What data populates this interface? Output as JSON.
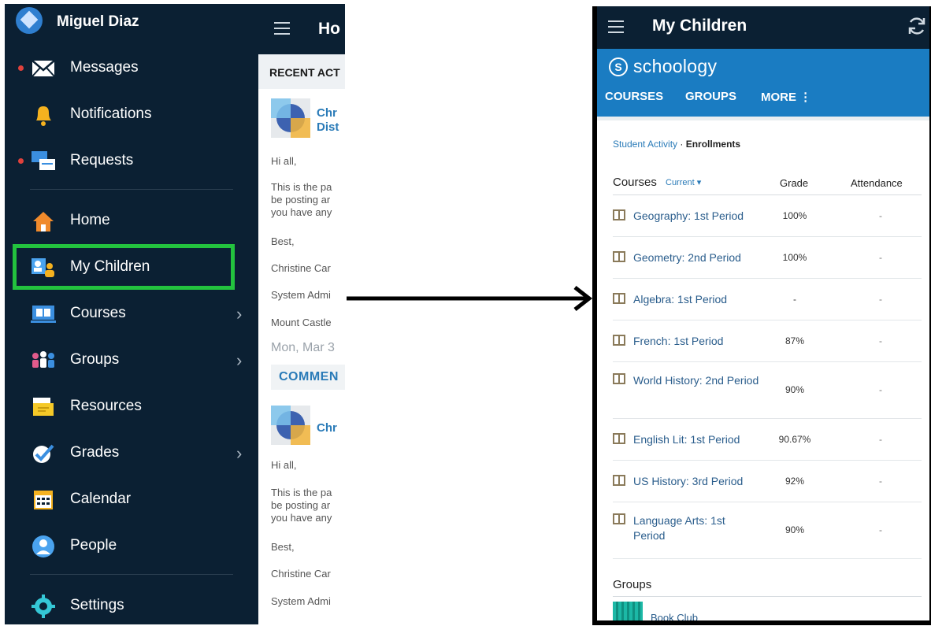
{
  "left_phone": {
    "profile_name": "Miguel Diaz",
    "menu": [
      {
        "label": "Messages",
        "icon": "envelope-icon",
        "unread": true,
        "chevron": false
      },
      {
        "label": "Notifications",
        "icon": "bell-icon",
        "unread": false,
        "chevron": false
      },
      {
        "label": "Requests",
        "icon": "requests-icon",
        "unread": true,
        "chevron": false
      },
      {
        "label": "Home",
        "icon": "home-icon",
        "unread": false,
        "chevron": false
      },
      {
        "label": "My Children",
        "icon": "children-icon",
        "unread": false,
        "chevron": false,
        "highlighted": true
      },
      {
        "label": "Courses",
        "icon": "courses-icon",
        "unread": false,
        "chevron": true
      },
      {
        "label": "Groups",
        "icon": "groups-icon",
        "unread": false,
        "chevron": true
      },
      {
        "label": "Resources",
        "icon": "resources-icon",
        "unread": false,
        "chevron": false
      },
      {
        "label": "Grades",
        "icon": "grades-icon",
        "unread": false,
        "chevron": true
      },
      {
        "label": "Calendar",
        "icon": "calendar-icon",
        "unread": false,
        "chevron": false
      },
      {
        "label": "People",
        "icon": "people-icon",
        "unread": false,
        "chevron": false
      },
      {
        "label": "Settings",
        "icon": "gear-icon",
        "unread": false,
        "chevron": false
      }
    ],
    "highlight_color": "#23c33e",
    "content": {
      "title": "Ho",
      "section": "RECENT ACT",
      "post1_author": [
        "Chr",
        "Dist"
      ],
      "post1_lines": [
        "Hi all,",
        "This is the pa",
        "be posting ar",
        "you have any",
        "Best,",
        "Christine Car",
        "System Admi",
        "Mount Castle"
      ],
      "date": "Mon, Mar 3",
      "comment_label": "COMMEN",
      "post2_author": "Chr",
      "post2_lines": [
        "Hi all,",
        "This is the pa",
        "be posting ar",
        "you have any",
        "Best,",
        "Christine Car",
        "System Admi"
      ]
    }
  },
  "right_phone": {
    "title": "My Children",
    "brand": "schoology",
    "tabs": [
      "COURSES",
      "GROUPS",
      "MORE ⋮"
    ],
    "breadcrumb": {
      "link": "Student Activity",
      "separator": " · ",
      "current": "Enrollments"
    },
    "table_header": {
      "courses": "Courses",
      "filter": "Current ▾",
      "grade": "Grade",
      "attendance": "Attendance"
    },
    "courses": [
      {
        "name": "Geography: 1st Period",
        "grade": "100%",
        "attendance": "-"
      },
      {
        "name": "Geometry: 2nd Period",
        "grade": "100%",
        "attendance": "-"
      },
      {
        "name": "Algebra: 1st Period",
        "grade": "-",
        "attendance": "-"
      },
      {
        "name": "French: 1st Period",
        "grade": "87%",
        "attendance": "-"
      },
      {
        "name": "World History: 2nd Period",
        "grade": "90%",
        "attendance": "-"
      },
      {
        "name": "English Lit: 1st Period",
        "grade": "90.67%",
        "attendance": "-"
      },
      {
        "name": "US History: 3rd Period",
        "grade": "92%",
        "attendance": "-"
      },
      {
        "name": "Language Arts: 1st Period",
        "grade": "90%",
        "attendance": "-"
      }
    ],
    "groups_title": "Groups",
    "groups": [
      {
        "name": "Book Club"
      }
    ],
    "accent_color": "#1a7cc2"
  }
}
